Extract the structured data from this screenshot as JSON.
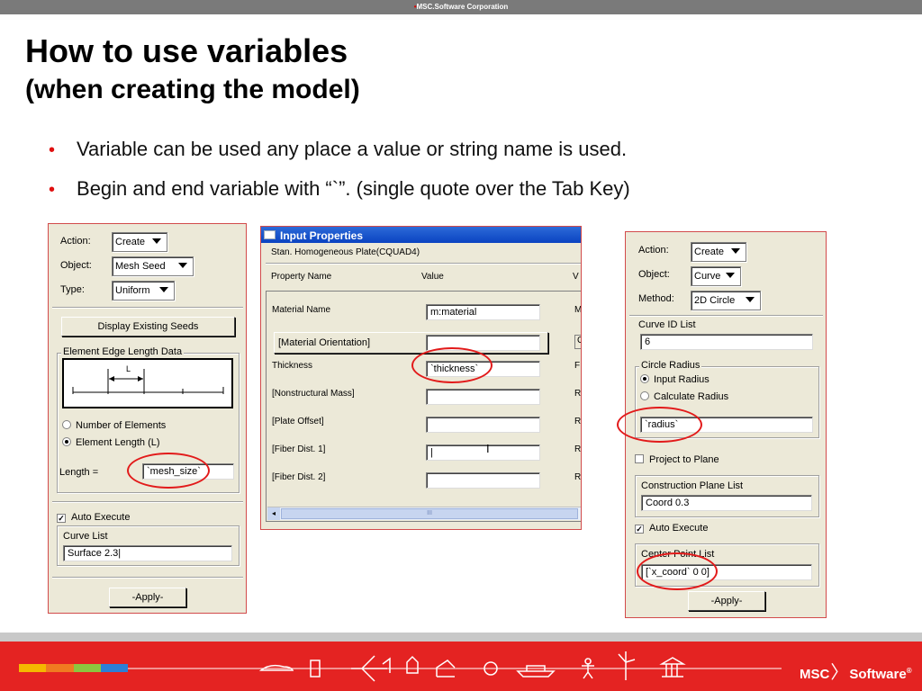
{
  "header": {
    "company": "MSC.Software Corporation"
  },
  "slide": {
    "title": "How to use variables",
    "subtitle": "(when creating the model)",
    "bullets": [
      "Variable can be used any place a value or string name is used.",
      "Begin and end variable with “`”.  (single quote over the Tab Key)"
    ]
  },
  "left_panel": {
    "action_label": "Action:",
    "action_value": "Create",
    "object_label": "Object:",
    "object_value": "Mesh Seed",
    "type_label": "Type:",
    "type_value": "Uniform",
    "display_button": "Display Existing Seeds",
    "edge_group": "Element Edge Length Data",
    "diagram_label": "L",
    "radio1": "Number of Elements",
    "radio2": "Element Length (L)",
    "length_label": "Length =",
    "length_value": "`mesh_size`",
    "auto_execute": "Auto Execute",
    "curve_list_label": "Curve List",
    "curve_list_value": "Surface 2.3",
    "apply": "-Apply-"
  },
  "input_properties": {
    "title": "Input Properties",
    "subtitle": "Stan. Homogeneous Plate(CQUAD4)",
    "col_property": "Property Name",
    "col_value": "Value",
    "col_v": "V",
    "rows": [
      {
        "name": "Material Name",
        "value": "m:material",
        "r": "M"
      },
      {
        "name": "[Material Orientation]",
        "value": "",
        "r": "C"
      },
      {
        "name": "Thickness",
        "value": "`thickness`",
        "r": "F"
      },
      {
        "name": "[Nonstructural Mass]",
        "value": "",
        "r": "R"
      },
      {
        "name": "[Plate Offset]",
        "value": "",
        "r": "R"
      },
      {
        "name": "[Fiber Dist. 1]",
        "value": "",
        "r": "R"
      },
      {
        "name": "[Fiber Dist. 2]",
        "value": "",
        "r": "R"
      }
    ],
    "scroll_grip": "III"
  },
  "right_panel": {
    "action_label": "Action:",
    "action_value": "Create",
    "object_label": "Object:",
    "object_value": "Curve",
    "method_label": "Method:",
    "method_value": "2D Circle",
    "curve_id_label": "Curve ID List",
    "curve_id_value": "6",
    "radius_group": "Circle Radius",
    "radio1": "Input Radius",
    "radio2": "Calculate Radius",
    "radius_value": "`radius`",
    "project_label": "Project to Plane",
    "plane_label": "Construction Plane List",
    "plane_value": "Coord 0.3",
    "auto_execute": "Auto Execute",
    "center_label": "Center Point List",
    "center_value": "[`x_coord` 0 0]",
    "apply": "-Apply-"
  },
  "footer": {
    "brand_left": "MSC",
    "brand_right": "Software",
    "colors": [
      "#f5b800",
      "#f07b21",
      "#8cc63f",
      "#2b7fd6"
    ]
  }
}
